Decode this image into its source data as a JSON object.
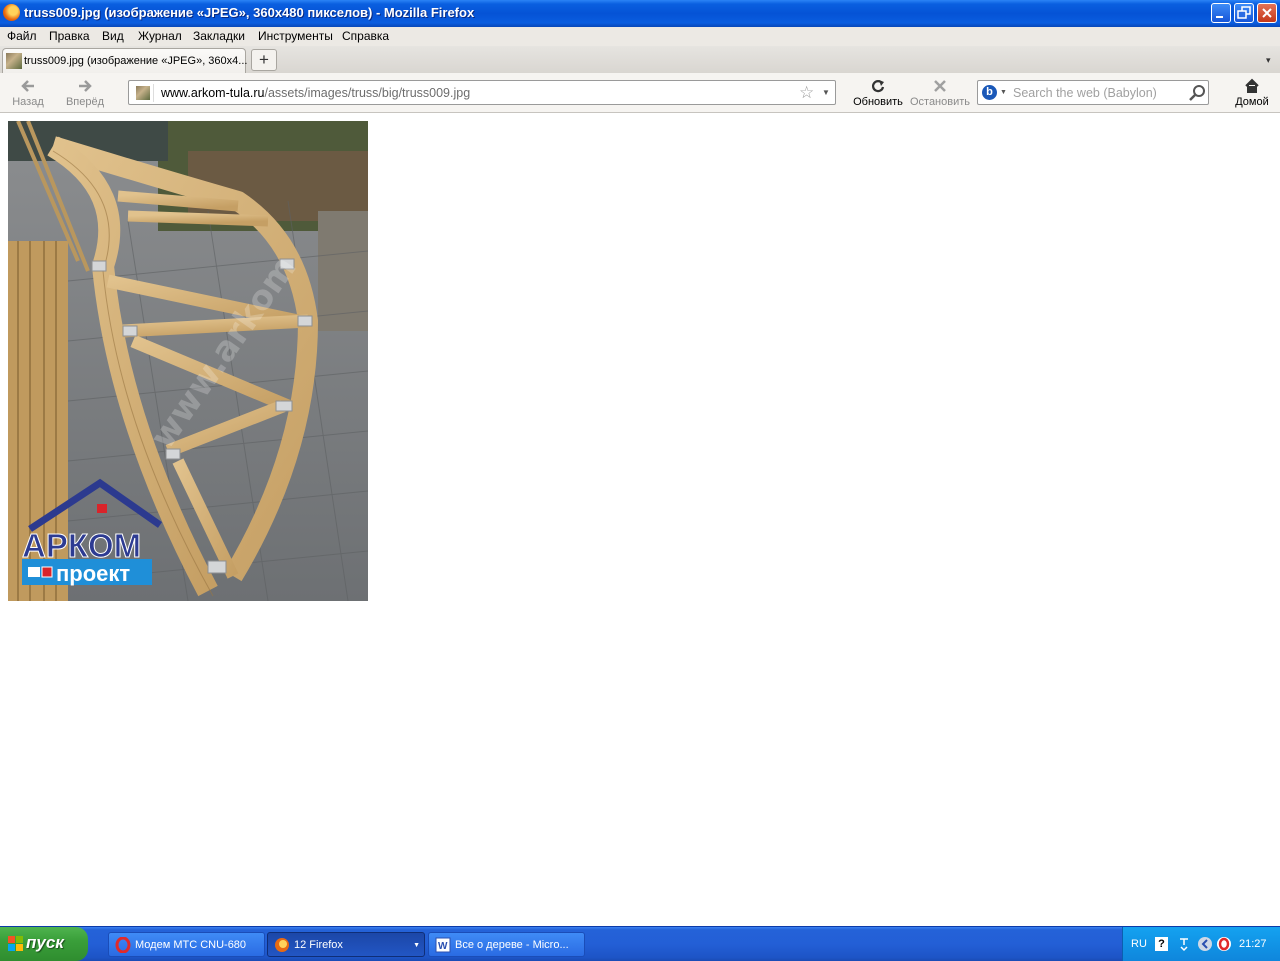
{
  "window": {
    "title": "truss009.jpg (изображение «JPEG», 360x480 пикселов) - Mozilla Firefox"
  },
  "menu": {
    "items": [
      "Файл",
      "Правка",
      "Вид",
      "Журнал",
      "Закладки",
      "Инструменты",
      "Справка"
    ]
  },
  "tab": {
    "label": "truss009.jpg (изображение «JPEG», 360x4...",
    "new_tab": "+"
  },
  "nav": {
    "back": "Назад",
    "forward": "Вперёд",
    "reload": "Обновить",
    "stop": "Остановить",
    "home": "Домой"
  },
  "address": {
    "domain": "www.arkom-tula.ru",
    "path": "/assets/images/truss/big/truss009.jpg"
  },
  "search": {
    "engine": "b",
    "placeholder": "Search the web (Babylon)"
  },
  "image": {
    "logo_top": "АРКОМ",
    "logo_bottom": "проект",
    "watermark": "www.arkom"
  },
  "taskbar": {
    "start": "пуск",
    "buttons": [
      {
        "label": "Модем МТС CNU-680"
      },
      {
        "label": "12 Firefox"
      },
      {
        "label": "Все о дереве - Micro..."
      }
    ],
    "lang": "RU",
    "help": "?",
    "clock": "21:27"
  }
}
